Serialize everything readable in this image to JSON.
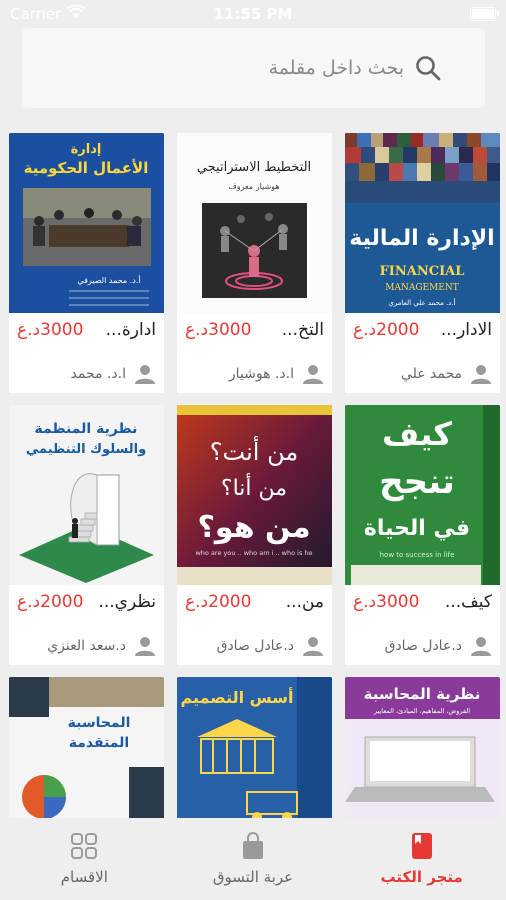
{
  "status_bar": {
    "carrier": "Carrier",
    "time": "11:55 PM"
  },
  "search": {
    "placeholder": "بحث داخل مقلمة"
  },
  "books": [
    {
      "title": "الادار...",
      "price": "2000د.ع",
      "author": "محمد علي",
      "cover_text_ar": "الإدارة المالية",
      "cover_text_en": "FINANCIAL MANAGEMENT",
      "cover_author": "أ.د. محمد علي العامري"
    },
    {
      "title": "التخ...",
      "price": "3000د.ع",
      "author": "ا.د. هوشيار",
      "cover_text_ar": "التخطيط الاستراتيجي",
      "cover_author": "هوشيار معروف"
    },
    {
      "title": "ادارة...",
      "price": "3000د.ع",
      "author": "ا.د. محمد",
      "cover_text_ar": "إدارة الأعمال الحكومية",
      "cover_author": "أ.د. محمد الصيرفي"
    },
    {
      "title": "كيف...",
      "price": "3000د.ع",
      "author": "د.عادل صادق",
      "cover_text_ar": "كيف تنجح في الحياة",
      "cover_text_en": "how to success in life"
    },
    {
      "title": "من...",
      "price": "2000د.ع",
      "author": "د.عادل صادق",
      "cover_text_ar": "من أنت؟ من أنا؟ من هو؟",
      "cover_text_en": "who are you .. who am i .. who is he"
    },
    {
      "title": "نظري...",
      "price": "2000د.ع",
      "author": "د.سعد العنزي",
      "cover_text_ar": "نظرية المنظمة والسلوك التنظيمي"
    },
    {
      "title": "",
      "price": "",
      "author": "",
      "cover_text_ar": "نظرية المحاسبة",
      "cover_sub": "الفروض، المفاهيم، المبادئ، المعايير"
    },
    {
      "title": "",
      "price": "",
      "author": "",
      "cover_text_ar": "أسس التصميم"
    },
    {
      "title": "",
      "price": "",
      "author": "",
      "cover_text_ar": "المحاسبة المتقدمة"
    }
  ],
  "tabs": [
    {
      "label": "متجر الكتب",
      "icon": "book-icon",
      "active": true
    },
    {
      "label": "عربة التسوق",
      "icon": "shopping-bag-icon",
      "active": false
    },
    {
      "label": "الاقسام",
      "icon": "categories-icon",
      "active": false
    }
  ],
  "colors": {
    "accent": "#e53935"
  }
}
